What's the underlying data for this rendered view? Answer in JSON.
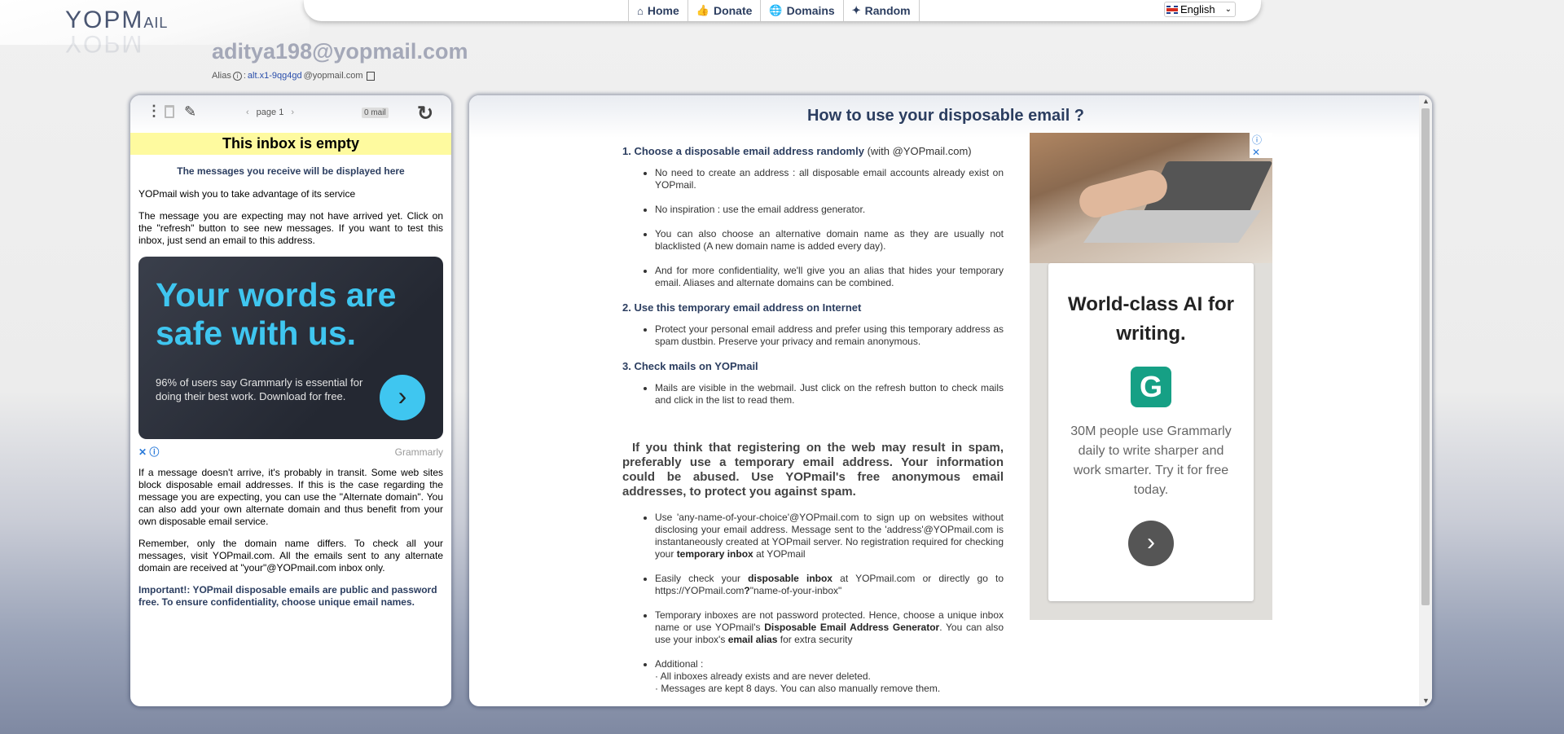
{
  "header": {
    "logo_main": "YOPM",
    "logo_small": "AIL",
    "nav": [
      {
        "icon": "home-icon",
        "glyph": "⌂",
        "label": "Home"
      },
      {
        "icon": "thumbs-up-icon",
        "glyph": "👍",
        "label": "Donate"
      },
      {
        "icon": "globe-icon",
        "glyph": "🌐",
        "label": "Domains"
      },
      {
        "icon": "magic-wand-icon",
        "glyph": "✦",
        "label": "Random"
      }
    ],
    "language": "English"
  },
  "inbox": {
    "email": "aditya198@yopmail.com",
    "alias_label": "Alias",
    "alias_value": "alt.x1-9qg4gd",
    "alias_domain": "@yopmail.com"
  },
  "left": {
    "page_label": "page 1",
    "mail_count": "0 mail",
    "empty_banner": "This inbox is empty",
    "displayed_here": "The messages you receive will be displayed here",
    "wish": "YOPmail wish you to take advantage of its service",
    "expecting": "The message you are expecting may not have arrived yet. Click on the \"refresh\" button to see new messages. If you want to test this inbox, just send an email to this address.",
    "ad": {
      "headline": "Your words are safe with us.",
      "body": "96% of users say Grammarly is essential for doing their best work. Download for free.",
      "arrow": "›",
      "brand": "Grammarly",
      "close": "✕ ⓘ"
    },
    "transit": "If a message doesn't arrive, it's probably in transit. Some web sites block disposable email addresses. If this is the case regarding the message you are expecting, you can use the \"Alternate domain\". You can also add your own alternate domain and thus benefit from your own disposable email service.",
    "remember": "Remember, only the domain name differs. To check all your messages, visit YOPmail.com. All the emails sent to any alternate domain are received at \"your\"@YOPmail.com inbox only.",
    "important": "Important!: YOPmail disposable emails are public and password free. To ensure confidentiality, choose unique email names."
  },
  "howto": {
    "title": "How to use your disposable email ?",
    "s1_title": "1. Choose a disposable email address randomly",
    "s1_suffix": "(with @YOPmail.com)",
    "s1_items": [
      "No need to create an address : all disposable email accounts already exist on YOPmail.",
      "No inspiration : use the email address generator.",
      "You can also choose an alternative domain name as they are usually not blacklisted (A new domain name is added every day).",
      "And for more confidentiality, we'll give you an alias that hides your temporary email. Aliases and alternate domains can be combined."
    ],
    "s2_title": "2. Use this temporary email address on Internet",
    "s2_items": [
      "Protect your personal email address and prefer using this temporary address as spam dustbin. Preserve your privacy and remain anonymous."
    ],
    "s3_title": "3. Check mails on YOPmail",
    "s3_items": [
      "Mails are visible in the webmail. Just click on the refresh button to check mails and click in the list to read them."
    ],
    "spam_para": "If you think that registering on the web may result in spam, preferably use a temporary email address. Your information could be abused. Use YOPmail's free anonymous email addresses, to protect you against spam.",
    "b1_text": "Use 'any-name-of-your-choice'@YOPmail.com to sign up on websites without disclosing your email address. Message sent to the 'address'@YOPmail.com is instantaneously created at YOPmail server. No registration required for checking your",
    "b1_bold": "temporary inbox",
    "b1_end": "at YOPmail",
    "b2_pre": "Easily check your",
    "b2_bold": "disposable inbox",
    "b2_mid": "at YOPmail.com or directly go to https://YOPmail.com",
    "b2_bold2": "?",
    "b2_end": "\"name-of-your-inbox\"",
    "b3_pre": "Temporary inboxes are not password protected. Hence, choose a unique inbox name or use YOPmail's",
    "b3_bold": "Disposable Email Address Generator",
    "b3_mid": ". You can also use your inbox's",
    "b3_bold2": "email alias",
    "b3_end": "for extra security",
    "b4_title": "Additional :",
    "b4_l1": "· All inboxes already exists and are never deleted.",
    "b4_l2": "· Messages are kept 8 days. You can also manually remove them."
  },
  "right_ad": {
    "headline": "World-class AI for writing.",
    "logo_letter": "G",
    "desc": "30M people use Grammarly daily to write sharper and work smarter. Try it for free today.",
    "arrow": "›",
    "close": "ⓘ ✕"
  },
  "colors": {
    "accent": "#2c3e60",
    "banner": "#fefa9f",
    "grammarly_blue": "#3fc6f0",
    "grammarly_green": "#16a085"
  }
}
